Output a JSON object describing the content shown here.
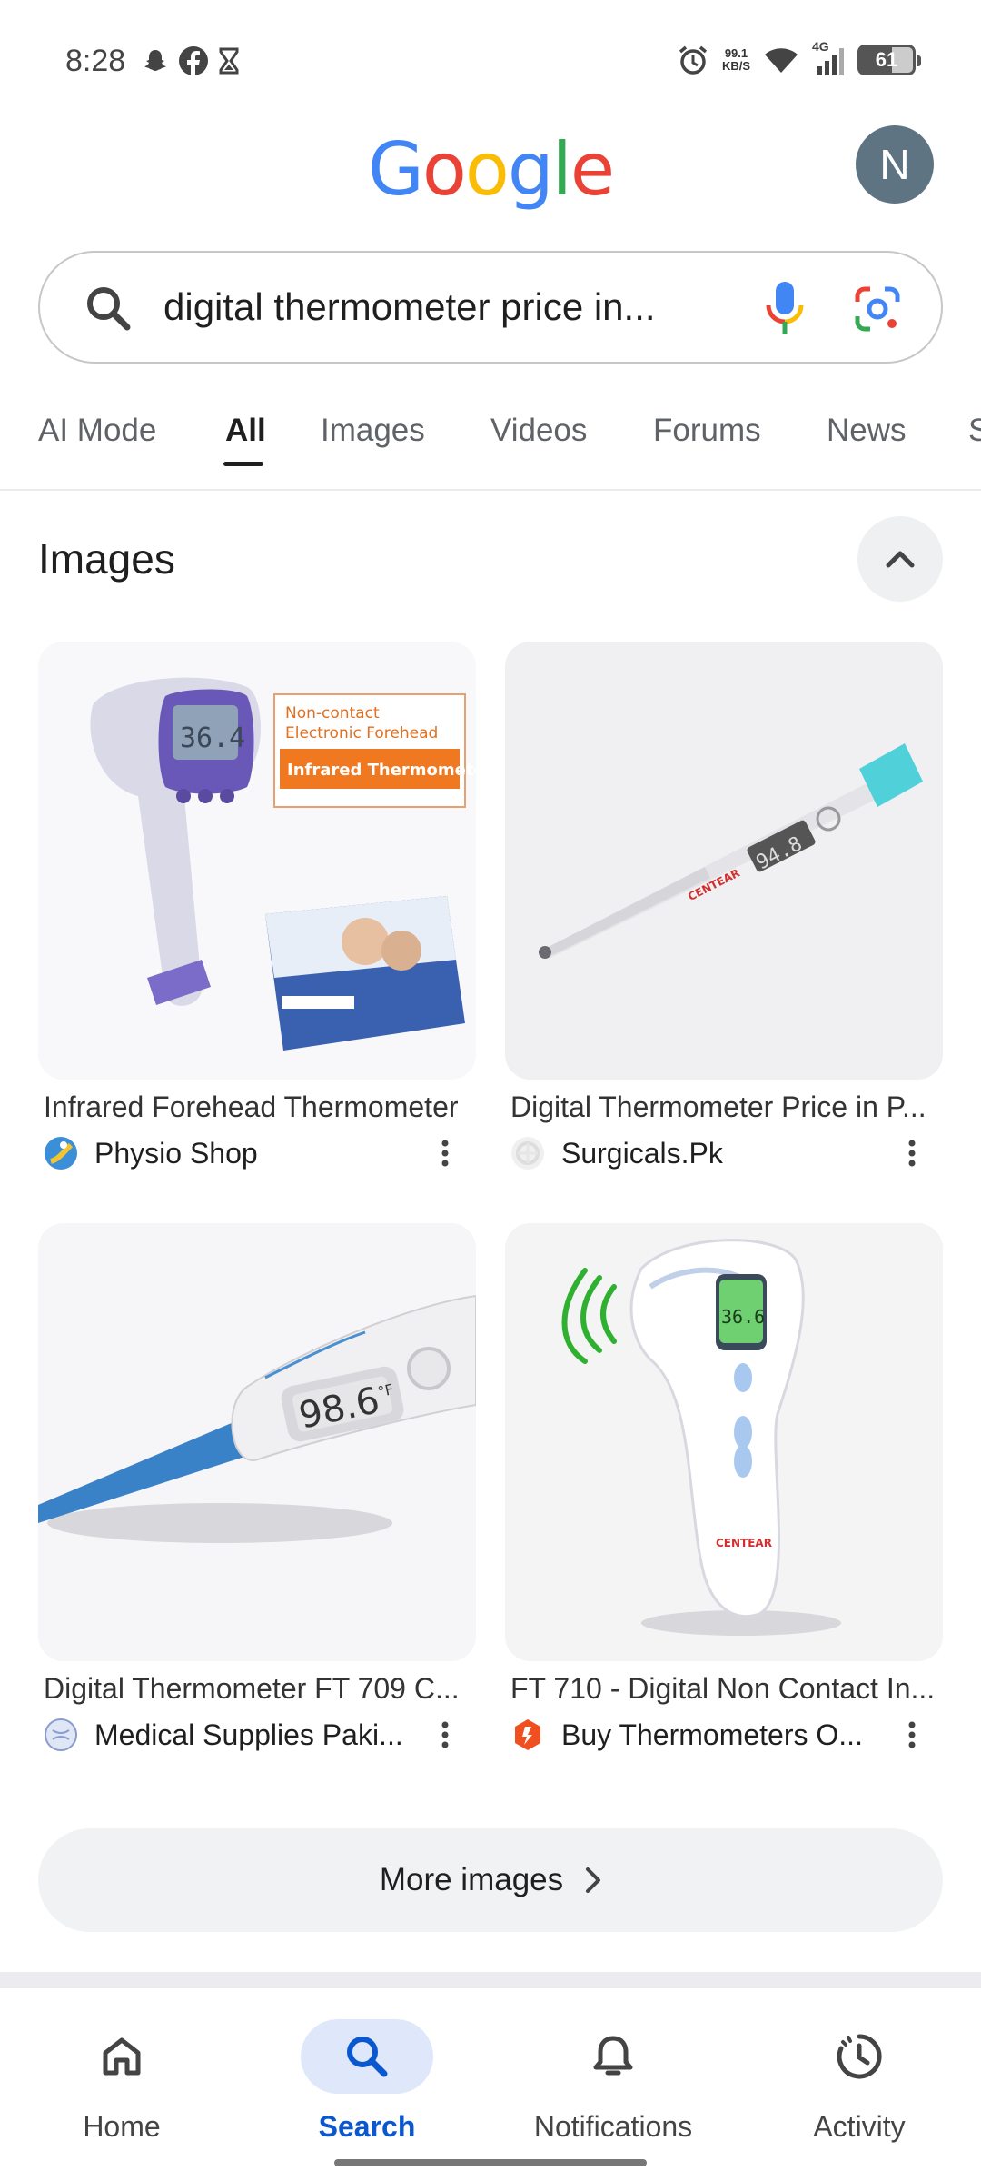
{
  "status_bar": {
    "time": "8:28",
    "left_icons": [
      "snapchat-icon",
      "facebook-icon",
      "hourglass-icon"
    ],
    "net_speed_value": "99.1",
    "net_speed_unit": "KB/S",
    "network": "4G",
    "battery": "61"
  },
  "header": {
    "logo_letters": [
      "G",
      "o",
      "o",
      "g",
      "l",
      "e"
    ],
    "logo_colors": [
      "#4285F4",
      "#EA4335",
      "#FBBC05",
      "#4285F4",
      "#34A853",
      "#EA4335"
    ],
    "avatar_initial": "N"
  },
  "search": {
    "query": "digital thermometer price in..."
  },
  "tabs": [
    "AI Mode",
    "All",
    "Images",
    "Videos",
    "Forums",
    "News",
    "S"
  ],
  "active_tab": "All",
  "images_section": {
    "title": "Images",
    "results": [
      {
        "title": "Infrared Forehead Thermometer",
        "source": "Physio Shop"
      },
      {
        "title": "Digital Thermometer Price in P...",
        "source": "Surgicals.Pk"
      },
      {
        "title": "Digital Thermometer FT 709 C...",
        "source": "Medical Supplies Paki..."
      },
      {
        "title": "FT 710 - Digital Non Contact In...",
        "source": "Buy Thermometers O..."
      }
    ],
    "image_texts": {
      "box_line1": "Non-contact",
      "box_line2": "Electronic Forehead",
      "box_banner": "Infrared Thermometer",
      "reading1": "36.4",
      "reading2": "94.8",
      "reading3": "98.6",
      "reading3_unit": "°F",
      "reading4": "36.6",
      "brand": "CENTEAR"
    },
    "more_label": "More images"
  },
  "bottom_nav": [
    {
      "label": "Home",
      "icon": "home-icon"
    },
    {
      "label": "Search",
      "icon": "search-icon"
    },
    {
      "label": "Notifications",
      "icon": "bell-icon"
    },
    {
      "label": "Activity",
      "icon": "activity-icon"
    }
  ],
  "colors": {
    "accent": "#0b57d0",
    "active_nav_bg": "#dfe8fb"
  }
}
